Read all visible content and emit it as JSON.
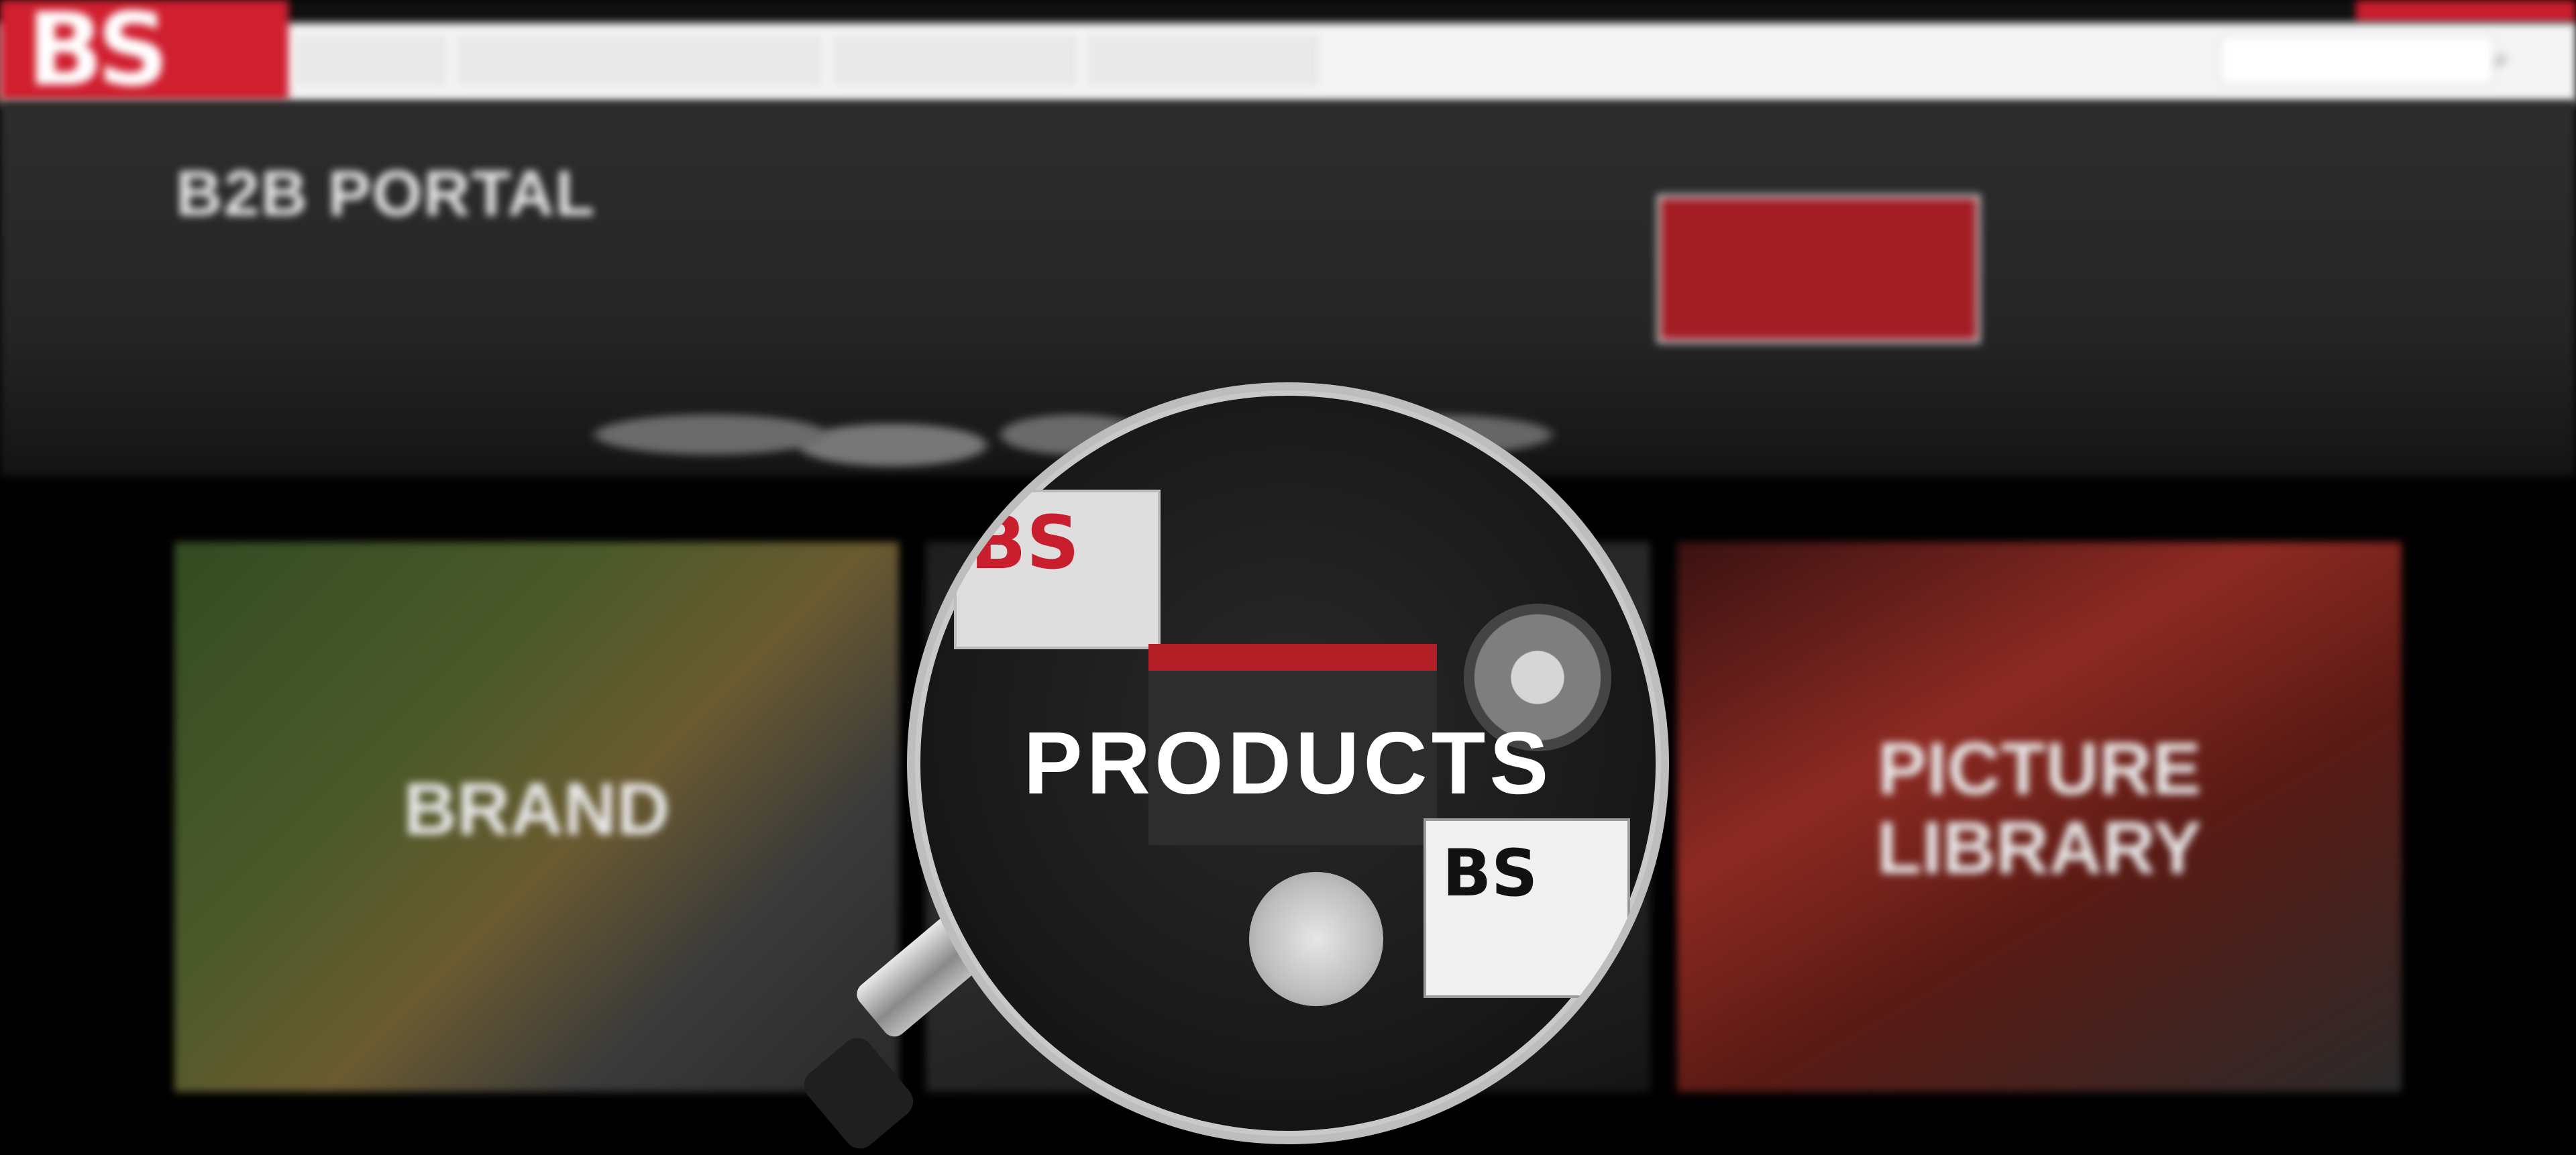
{
  "header": {
    "logo_text": "BS",
    "top_links": [
      "",
      "",
      "",
      "",
      ""
    ],
    "nav": [
      "",
      "",
      "",
      ""
    ],
    "search_placeholder": ""
  },
  "hero": {
    "title": "B2B PORTAL",
    "subtitle": ""
  },
  "tiles": {
    "brand": "BRAND",
    "products": "PRODUCTS",
    "picture_library_line1": "PICTURE",
    "picture_library_line2": "LIBRARY"
  },
  "lens": {
    "battery_logo_1": "BS",
    "battery_logo_2": "BS"
  },
  "colors": {
    "brand_red": "#d01f2f",
    "background": "#000000",
    "nav_bg": "#f4f4f4"
  }
}
